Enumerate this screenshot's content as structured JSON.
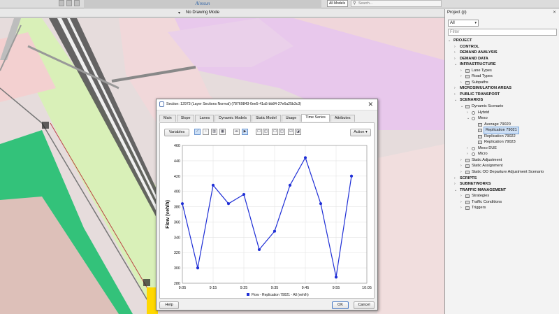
{
  "app": {
    "logo_text": "Aimsun",
    "models_select": "All Models",
    "search_placeholder": "Search..."
  },
  "drawing": {
    "mode_label": "No Drawing Mode"
  },
  "project_panel": {
    "title": "Project (p)",
    "filter_select": "All",
    "filter_placeholder": "Filter",
    "tree": [
      {
        "label": "PROJECT",
        "level": 0,
        "bold": true,
        "arrow": "v"
      },
      {
        "label": "CONTROL",
        "level": 1,
        "bold": true,
        "arrow": ">"
      },
      {
        "label": "DEMAND ANALYSIS",
        "level": 1,
        "bold": true,
        "arrow": ">"
      },
      {
        "label": "DEMAND DATA",
        "level": 1,
        "bold": true,
        "arrow": ">"
      },
      {
        "label": "INFRASTRUCTURE",
        "level": 1,
        "bold": true,
        "arrow": "v"
      },
      {
        "label": "Lane Types",
        "level": 2,
        "arrow": ">",
        "icon": "folder"
      },
      {
        "label": "Road Types",
        "level": 2,
        "arrow": ">",
        "icon": "folder"
      },
      {
        "label": "Subpaths",
        "level": 2,
        "arrow": ">",
        "icon": "folder"
      },
      {
        "label": "MICROSIMULATION AREAS",
        "level": 1,
        "bold": true,
        "arrow": ">"
      },
      {
        "label": "PUBLIC TRANSPORT",
        "level": 1,
        "bold": true,
        "arrow": ">"
      },
      {
        "label": "SCENARIOS",
        "level": 1,
        "bold": true,
        "arrow": "v"
      },
      {
        "label": "Dynamic Scenario",
        "level": 2,
        "arrow": "v",
        "icon": "folder"
      },
      {
        "label": "Hybrid",
        "level": 3,
        "arrow": ">",
        "icon": "radio"
      },
      {
        "label": "Meso",
        "level": 3,
        "arrow": "v",
        "icon": "radio"
      },
      {
        "label": "Average 79020",
        "level": 4,
        "icon": "doc"
      },
      {
        "label": "Replication 79021",
        "level": 4,
        "icon": "doc",
        "selected": true
      },
      {
        "label": "Replication 79022",
        "level": 4,
        "icon": "doc"
      },
      {
        "label": "Replication 79023",
        "level": 4,
        "icon": "doc"
      },
      {
        "label": "Meso DUE",
        "level": 3,
        "arrow": ">",
        "icon": "radio"
      },
      {
        "label": "Micro",
        "level": 3,
        "arrow": ">",
        "icon": "radio"
      },
      {
        "label": "Static Adjustment",
        "level": 2,
        "arrow": ">",
        "icon": "folder"
      },
      {
        "label": "Static Assignment",
        "level": 2,
        "arrow": ">",
        "icon": "folder"
      },
      {
        "label": "Static OD Departure Adjustment Scenario",
        "level": 2,
        "arrow": ">",
        "icon": "folder"
      },
      {
        "label": "SCRIPTS",
        "level": 1,
        "bold": true,
        "arrow": ">"
      },
      {
        "label": "SUBNETWORKS",
        "level": 1,
        "bold": true,
        "arrow": ">"
      },
      {
        "label": "TRAFFIC MANAGEMENT",
        "level": 1,
        "bold": true,
        "arrow": "v"
      },
      {
        "label": "Strategies",
        "level": 2,
        "arrow": ">",
        "icon": "folder"
      },
      {
        "label": "Traffic Conditions",
        "level": 2,
        "arrow": ">",
        "icon": "folder"
      },
      {
        "label": "Triggers",
        "level": 2,
        "arrow": ">",
        "icon": "folder"
      }
    ]
  },
  "dialog": {
    "title": "Section: 12973 (Layer Sections Normal) (78769843-0ee5-41a5-bb84-27e6a25b3c3)",
    "tabs": [
      "Main",
      "Slope",
      "Lanes",
      "Dynamic Models",
      "Static Model",
      "Usage",
      "Time Series",
      "Attributes"
    ],
    "active_tab": "Time Series",
    "variables_button": "Variables",
    "action_button": "Action",
    "help_button": "Help",
    "ok_button": "OK",
    "cancel_button": "Cancel"
  },
  "chart_data": {
    "type": "line",
    "x": [
      "9:05",
      "9:10",
      "9:15",
      "9:20",
      "9:25",
      "9:30",
      "9:35",
      "9:40",
      "9:45",
      "9:50",
      "9:55",
      "10:00"
    ],
    "x_tick_labels": [
      "9:05",
      "9:15",
      "9:25",
      "9:35",
      "9:45",
      "9:55",
      "10:05"
    ],
    "series": [
      {
        "name": "Flow - Replication 79021 - All (veh/h)",
        "values": [
          384,
          300,
          408,
          384,
          396,
          324,
          348,
          408,
          444,
          384,
          288,
          420
        ],
        "color": "#1f2fd6"
      }
    ],
    "ylabel": "Flow (veh/h)",
    "xlabel": "",
    "ylim": [
      280,
      460
    ],
    "y_ticks": [
      280,
      300,
      320,
      340,
      360,
      380,
      400,
      420,
      440,
      460
    ],
    "xlim_minutes": [
      0,
      60
    ],
    "grid": true,
    "legend_position": "bottom"
  }
}
